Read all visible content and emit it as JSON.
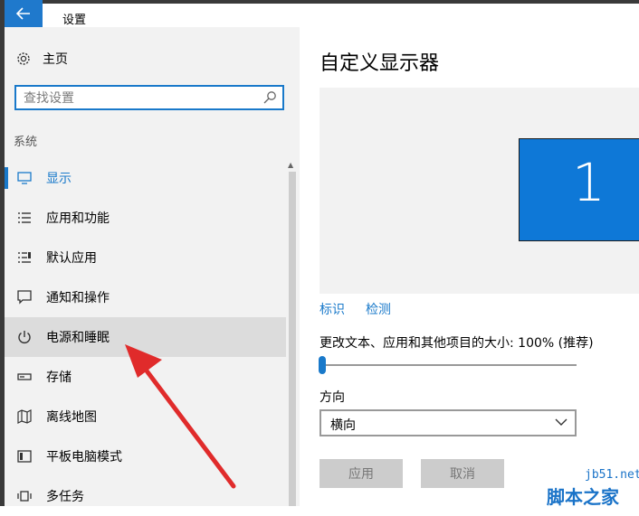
{
  "window": {
    "title": "设置"
  },
  "sidebar": {
    "home_label": "主页",
    "search_placeholder": "查找设置",
    "section_label": "系统",
    "items": [
      {
        "label": "显示",
        "icon": "monitor-icon",
        "state": "active"
      },
      {
        "label": "应用和功能",
        "icon": "apps-list-icon"
      },
      {
        "label": "默认应用",
        "icon": "default-apps-icon"
      },
      {
        "label": "通知和操作",
        "icon": "notification-icon"
      },
      {
        "label": "电源和睡眠",
        "icon": "power-icon",
        "state": "hovered"
      },
      {
        "label": "存储",
        "icon": "storage-icon"
      },
      {
        "label": "离线地图",
        "icon": "map-icon"
      },
      {
        "label": "平板电脑模式",
        "icon": "tablet-mode-icon"
      },
      {
        "label": "多任务",
        "icon": "multitask-icon"
      }
    ]
  },
  "main": {
    "title": "自定义显示器",
    "monitor_number": "1",
    "identify_link": "标识",
    "detect_link": "检测",
    "scale_label": "更改文本、应用和其他项目的大小: 100% (推荐)",
    "scale_value_fraction": 0.0,
    "orientation_label": "方向",
    "orientation_value": "横向",
    "apply_button": "应用",
    "cancel_button": "取消"
  },
  "watermark": {
    "site": "jb51.net",
    "name": "脚本之家"
  },
  "colors": {
    "accent": "#1979ca",
    "monitor": "#0e78d7",
    "arrow": "#e02b2b"
  }
}
